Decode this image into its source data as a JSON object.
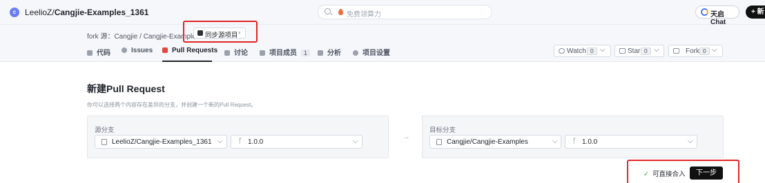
{
  "header": {
    "avatar_letter": "c",
    "owner": "LeelioZ/",
    "repo": "Cangjie-Examples_1361",
    "search_placeholder": "免费领算力",
    "ai_chat_label": "天启Chat",
    "new_label": "+ 新"
  },
  "fork": {
    "source_text": "fork 源：Cangjie / Cangjie-Examples",
    "sync_label": "同步源项目",
    "sync_chevron": "›"
  },
  "tabs": [
    {
      "label": "代码",
      "icon": "code-icon"
    },
    {
      "label": "Issues",
      "icon": "issues-icon"
    },
    {
      "label": "Pull Requests",
      "icon": "pull-request-icon",
      "active": true
    },
    {
      "label": "讨论",
      "icon": "discussion-icon"
    },
    {
      "label": "项目成员",
      "icon": "members-icon",
      "count": "1"
    },
    {
      "label": "分析",
      "icon": "analytics-icon"
    },
    {
      "label": "项目设置",
      "icon": "settings-icon"
    }
  ],
  "repo_actions": {
    "watch": {
      "label": "Watch",
      "count": "0"
    },
    "star": {
      "label": "Star",
      "count": "0"
    },
    "fork": {
      "label": "Fork",
      "count": "0"
    }
  },
  "page": {
    "title": "新建Pull Request",
    "description": "你可以选择两个内容存在差异的分支，并创建一个新的Pull Request。"
  },
  "source": {
    "label": "源分支",
    "repo": "LeelioZ/Cangjie-Examples_1361",
    "branch": "1.0.0"
  },
  "target": {
    "label": "目标分支",
    "repo": "Cangjie/Cangjie-Examples",
    "branch": "1.0.0"
  },
  "glyphs": {
    "chevron": "⌵",
    "arrow": "→",
    "check": "✓",
    "branch": "ᚴ"
  },
  "footer": {
    "mergeable_text": "可直接合入",
    "next_label": "下一步"
  },
  "colors": {
    "accent": "#e8453c",
    "highlight": "#e02424",
    "success": "#2ea043",
    "primary_button": "#111111"
  }
}
